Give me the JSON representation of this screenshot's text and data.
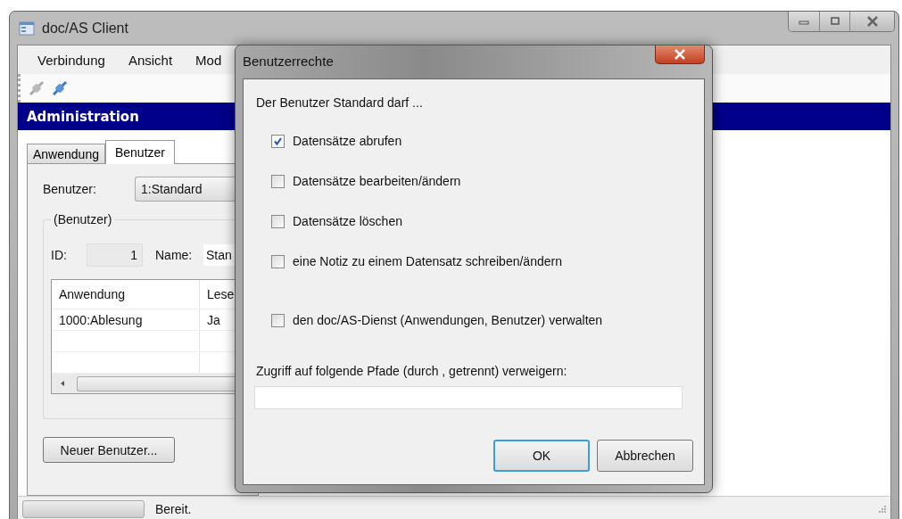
{
  "main_window": {
    "title": "doc/AS Client",
    "menu": [
      "Verbindung",
      "Ansicht",
      "Mod"
    ],
    "section_header": "Administration",
    "tabs": [
      {
        "label": "Anwendung",
        "selected": false
      },
      {
        "label": "Benutzer",
        "selected": true
      }
    ],
    "user_label": "Benutzer:",
    "user_select": "1:Standard",
    "group": {
      "title": "(Benutzer)",
      "id_label": "ID:",
      "id_value": "1",
      "name_label": "Name:",
      "name_value": "Stan",
      "table": {
        "columns": [
          "Anwendung",
          "Lese"
        ],
        "rows": [
          [
            "1000:Ablesung",
            "Ja"
          ]
        ]
      }
    },
    "new_user_button": "Neuer Benutzer...",
    "status": "Bereit."
  },
  "dialog": {
    "title": "Benutzerrechte",
    "intro": "Der Benutzer Standard darf ...",
    "permissions": [
      {
        "label": "Datensätze abrufen",
        "checked": true
      },
      {
        "label": "Datensätze bearbeiten/ändern",
        "checked": false
      },
      {
        "label": "Datensätze löschen",
        "checked": false
      },
      {
        "label": "eine Notiz zu einem Datensatz schreiben/ändern",
        "checked": false
      },
      {
        "label": "den doc/AS-Dienst (Anwendungen, Benutzer) verwalten",
        "checked": false
      }
    ],
    "paths_label": "Zugriff auf folgende Pfade (durch , getrennt) verweigern:",
    "buttons": [
      {
        "label": "OK",
        "default": true
      },
      {
        "label": "Abbrechen",
        "default": false
      }
    ]
  }
}
